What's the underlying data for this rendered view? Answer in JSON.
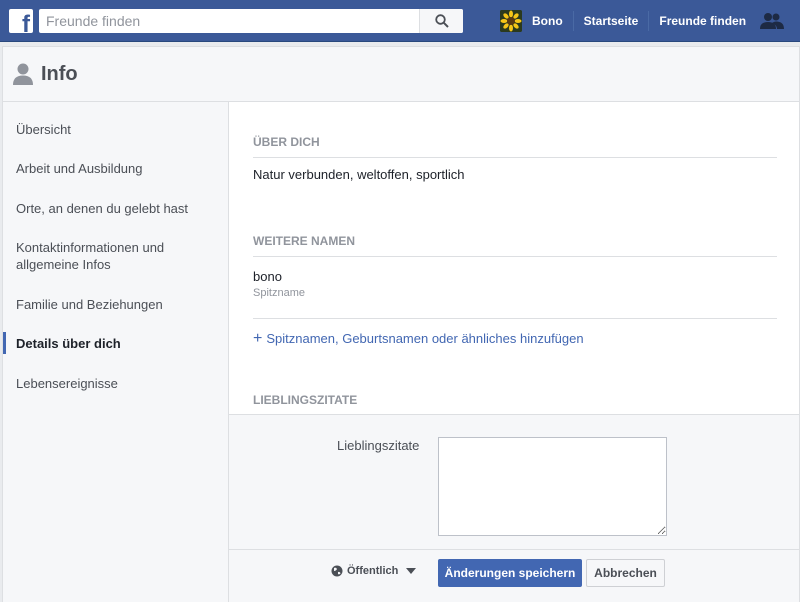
{
  "topbar": {
    "search_placeholder": "Freunde finden",
    "user_name": "Bono",
    "links": [
      "Startseite",
      "Freunde finden"
    ],
    "brand_color": "#3b5998"
  },
  "page": {
    "title": "Info"
  },
  "sidebar": {
    "items": [
      {
        "label": "Übersicht"
      },
      {
        "label": "Arbeit und Ausbildung"
      },
      {
        "label": "Orte, an denen du gelebt hast"
      },
      {
        "label": "Kontaktinformationen und allgemeine Infos"
      },
      {
        "label": "Familie und Beziehungen"
      },
      {
        "label": "Details über dich",
        "active": true
      },
      {
        "label": "Lebensereignisse"
      }
    ]
  },
  "about": {
    "heading": "ÜBER DICH",
    "text": "Natur verbunden, weltoffen, sportlich"
  },
  "other_names": {
    "heading": "WEITERE NAMEN",
    "name": "bono",
    "type": "Spitzname",
    "add_label": "Spitznamen, Geburtsnamen oder ähnliches hinzufügen"
  },
  "quotes": {
    "heading": "LIEBLINGSZITATE",
    "field_label": "Lieblingszitate",
    "field_value": "",
    "privacy_label": "Öffentlich",
    "save_label": "Änderungen speichern",
    "cancel_label": "Abbrechen"
  },
  "colors": {
    "accent": "#4267b2",
    "sidebar_bg": "#f6f7f9"
  }
}
